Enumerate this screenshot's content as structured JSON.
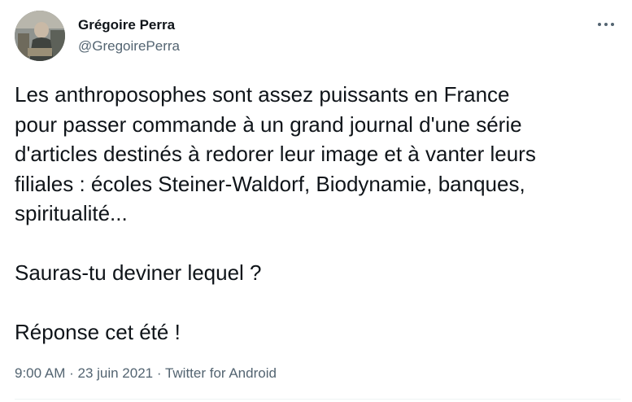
{
  "author": {
    "name": "Grégoire Perra",
    "handle": "@GregoirePerra",
    "avatar_icon": "profile-photo"
  },
  "menu": {
    "more_icon": "more-horizontal-icon"
  },
  "tweet": {
    "paragraph1": "Les anthroposophes sont assez puissants en France\npour passer commande à un grand journal d'une série\nd'articles destinés à redorer leur image et à vanter leurs\nfiliales : écoles Steiner-Waldorf, Biodynamie, banques,\nspiritualité...",
    "paragraph2": "Sauras-tu deviner lequel ?",
    "paragraph3": "Réponse cet été !"
  },
  "meta": {
    "time": "9:00 AM",
    "sep1": " · ",
    "date": "23 juin 2021",
    "sep2": " · ",
    "source": "Twitter for Android"
  },
  "colors": {
    "text": "#0f1419",
    "secondary": "#536471",
    "divider": "#eff3f4"
  }
}
